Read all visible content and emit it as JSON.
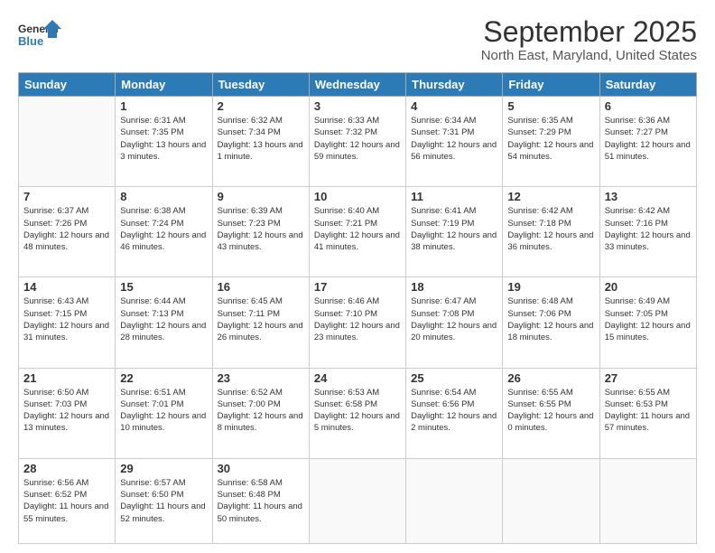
{
  "logo": {
    "general": "General",
    "blue": "Blue"
  },
  "header": {
    "title": "September 2025",
    "subtitle": "North East, Maryland, United States"
  },
  "weekdays": [
    "Sunday",
    "Monday",
    "Tuesday",
    "Wednesday",
    "Thursday",
    "Friday",
    "Saturday"
  ],
  "weeks": [
    [
      {
        "day": "",
        "sunrise": "",
        "sunset": "",
        "daylight": ""
      },
      {
        "day": "1",
        "sunrise": "Sunrise: 6:31 AM",
        "sunset": "Sunset: 7:35 PM",
        "daylight": "Daylight: 13 hours and 3 minutes."
      },
      {
        "day": "2",
        "sunrise": "Sunrise: 6:32 AM",
        "sunset": "Sunset: 7:34 PM",
        "daylight": "Daylight: 13 hours and 1 minute."
      },
      {
        "day": "3",
        "sunrise": "Sunrise: 6:33 AM",
        "sunset": "Sunset: 7:32 PM",
        "daylight": "Daylight: 12 hours and 59 minutes."
      },
      {
        "day": "4",
        "sunrise": "Sunrise: 6:34 AM",
        "sunset": "Sunset: 7:31 PM",
        "daylight": "Daylight: 12 hours and 56 minutes."
      },
      {
        "day": "5",
        "sunrise": "Sunrise: 6:35 AM",
        "sunset": "Sunset: 7:29 PM",
        "daylight": "Daylight: 12 hours and 54 minutes."
      },
      {
        "day": "6",
        "sunrise": "Sunrise: 6:36 AM",
        "sunset": "Sunset: 7:27 PM",
        "daylight": "Daylight: 12 hours and 51 minutes."
      }
    ],
    [
      {
        "day": "7",
        "sunrise": "Sunrise: 6:37 AM",
        "sunset": "Sunset: 7:26 PM",
        "daylight": "Daylight: 12 hours and 48 minutes."
      },
      {
        "day": "8",
        "sunrise": "Sunrise: 6:38 AM",
        "sunset": "Sunset: 7:24 PM",
        "daylight": "Daylight: 12 hours and 46 minutes."
      },
      {
        "day": "9",
        "sunrise": "Sunrise: 6:39 AM",
        "sunset": "Sunset: 7:23 PM",
        "daylight": "Daylight: 12 hours and 43 minutes."
      },
      {
        "day": "10",
        "sunrise": "Sunrise: 6:40 AM",
        "sunset": "Sunset: 7:21 PM",
        "daylight": "Daylight: 12 hours and 41 minutes."
      },
      {
        "day": "11",
        "sunrise": "Sunrise: 6:41 AM",
        "sunset": "Sunset: 7:19 PM",
        "daylight": "Daylight: 12 hours and 38 minutes."
      },
      {
        "day": "12",
        "sunrise": "Sunrise: 6:42 AM",
        "sunset": "Sunset: 7:18 PM",
        "daylight": "Daylight: 12 hours and 36 minutes."
      },
      {
        "day": "13",
        "sunrise": "Sunrise: 6:42 AM",
        "sunset": "Sunset: 7:16 PM",
        "daylight": "Daylight: 12 hours and 33 minutes."
      }
    ],
    [
      {
        "day": "14",
        "sunrise": "Sunrise: 6:43 AM",
        "sunset": "Sunset: 7:15 PM",
        "daylight": "Daylight: 12 hours and 31 minutes."
      },
      {
        "day": "15",
        "sunrise": "Sunrise: 6:44 AM",
        "sunset": "Sunset: 7:13 PM",
        "daylight": "Daylight: 12 hours and 28 minutes."
      },
      {
        "day": "16",
        "sunrise": "Sunrise: 6:45 AM",
        "sunset": "Sunset: 7:11 PM",
        "daylight": "Daylight: 12 hours and 26 minutes."
      },
      {
        "day": "17",
        "sunrise": "Sunrise: 6:46 AM",
        "sunset": "Sunset: 7:10 PM",
        "daylight": "Daylight: 12 hours and 23 minutes."
      },
      {
        "day": "18",
        "sunrise": "Sunrise: 6:47 AM",
        "sunset": "Sunset: 7:08 PM",
        "daylight": "Daylight: 12 hours and 20 minutes."
      },
      {
        "day": "19",
        "sunrise": "Sunrise: 6:48 AM",
        "sunset": "Sunset: 7:06 PM",
        "daylight": "Daylight: 12 hours and 18 minutes."
      },
      {
        "day": "20",
        "sunrise": "Sunrise: 6:49 AM",
        "sunset": "Sunset: 7:05 PM",
        "daylight": "Daylight: 12 hours and 15 minutes."
      }
    ],
    [
      {
        "day": "21",
        "sunrise": "Sunrise: 6:50 AM",
        "sunset": "Sunset: 7:03 PM",
        "daylight": "Daylight: 12 hours and 13 minutes."
      },
      {
        "day": "22",
        "sunrise": "Sunrise: 6:51 AM",
        "sunset": "Sunset: 7:01 PM",
        "daylight": "Daylight: 12 hours and 10 minutes."
      },
      {
        "day": "23",
        "sunrise": "Sunrise: 6:52 AM",
        "sunset": "Sunset: 7:00 PM",
        "daylight": "Daylight: 12 hours and 8 minutes."
      },
      {
        "day": "24",
        "sunrise": "Sunrise: 6:53 AM",
        "sunset": "Sunset: 6:58 PM",
        "daylight": "Daylight: 12 hours and 5 minutes."
      },
      {
        "day": "25",
        "sunrise": "Sunrise: 6:54 AM",
        "sunset": "Sunset: 6:56 PM",
        "daylight": "Daylight: 12 hours and 2 minutes."
      },
      {
        "day": "26",
        "sunrise": "Sunrise: 6:55 AM",
        "sunset": "Sunset: 6:55 PM",
        "daylight": "Daylight: 12 hours and 0 minutes."
      },
      {
        "day": "27",
        "sunrise": "Sunrise: 6:55 AM",
        "sunset": "Sunset: 6:53 PM",
        "daylight": "Daylight: 11 hours and 57 minutes."
      }
    ],
    [
      {
        "day": "28",
        "sunrise": "Sunrise: 6:56 AM",
        "sunset": "Sunset: 6:52 PM",
        "daylight": "Daylight: 11 hours and 55 minutes."
      },
      {
        "day": "29",
        "sunrise": "Sunrise: 6:57 AM",
        "sunset": "Sunset: 6:50 PM",
        "daylight": "Daylight: 11 hours and 52 minutes."
      },
      {
        "day": "30",
        "sunrise": "Sunrise: 6:58 AM",
        "sunset": "Sunset: 6:48 PM",
        "daylight": "Daylight: 11 hours and 50 minutes."
      },
      {
        "day": "",
        "sunrise": "",
        "sunset": "",
        "daylight": ""
      },
      {
        "day": "",
        "sunrise": "",
        "sunset": "",
        "daylight": ""
      },
      {
        "day": "",
        "sunrise": "",
        "sunset": "",
        "daylight": ""
      },
      {
        "day": "",
        "sunrise": "",
        "sunset": "",
        "daylight": ""
      }
    ]
  ]
}
